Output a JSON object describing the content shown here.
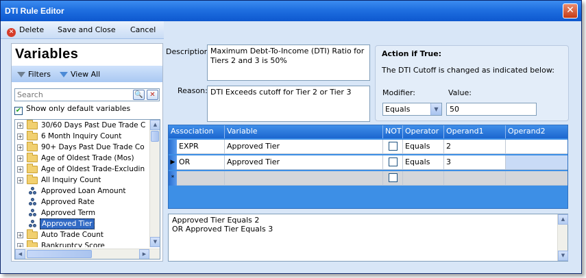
{
  "window": {
    "title": "DTI Rule Editor",
    "close_glyph": "✕"
  },
  "toolbar": {
    "delete_label": "Delete",
    "save_close_label": "Save and Close",
    "cancel_label": "Cancel"
  },
  "variables": {
    "title": "Variables",
    "filters_label": "Filters",
    "view_all_label": "View All",
    "search_placeholder": "Search",
    "show_default_label": "Show only default variables",
    "show_default_checked": true,
    "items": [
      {
        "label": "30/60 Days Past Due Trade C",
        "kind": "folder"
      },
      {
        "label": "6 Month Inquiry Count",
        "kind": "folder"
      },
      {
        "label": "90+ Days Past Due Trade Co",
        "kind": "folder"
      },
      {
        "label": "Age of Oldest Trade (Mos)",
        "kind": "folder"
      },
      {
        "label": "Age of Oldest Trade-Excludin",
        "kind": "folder"
      },
      {
        "label": "All Inquiry Count",
        "kind": "folder"
      },
      {
        "label": "Approved Loan Amount",
        "kind": "variable"
      },
      {
        "label": "Approved Rate",
        "kind": "variable"
      },
      {
        "label": "Approved Term",
        "kind": "variable"
      },
      {
        "label": "Approved Tier",
        "kind": "variable",
        "selected": true
      },
      {
        "label": "Auto Trade Count",
        "kind": "folder"
      },
      {
        "label": "Bankruptcy Score",
        "kind": "folder"
      }
    ]
  },
  "description": {
    "label": "Description:",
    "value": "Maximum Debt-To-Income (DTI) Ratio for Tiers 2 and 3 is 50%"
  },
  "reason": {
    "label": "Reason:",
    "value": "DTI Exceeds cutoff for Tier 2 or Tier 3"
  },
  "action": {
    "title": "Action if True:",
    "text": "The DTI Cutoff is changed as indicated below:",
    "modifier_label": "Modifier:",
    "modifier_value": "Equals",
    "value_label": "Value:",
    "value": "50"
  },
  "grid": {
    "columns": [
      "Association",
      "Variable",
      "NOT",
      "Operator",
      "Operand1",
      "Operand2"
    ],
    "rows": [
      {
        "association": "EXPR",
        "variable": "Approved Tier",
        "not": false,
        "operator": "Equals",
        "operand1": "2",
        "operand2": ""
      },
      {
        "association": "OR",
        "variable": "Approved Tier",
        "not": false,
        "operator": "Equals",
        "operand1": "3",
        "operand2": ""
      }
    ],
    "new_row_marker": "*",
    "current_row_marker": "▶"
  },
  "summary": {
    "text": "Approved Tier Equals 2\nOR Approved Tier Equals 3"
  },
  "colors": {
    "title_bar": "#1f6fe0",
    "grid_header": "#1c66cf",
    "selection": "#316ac5",
    "window_bg": "#d8e6f7"
  }
}
